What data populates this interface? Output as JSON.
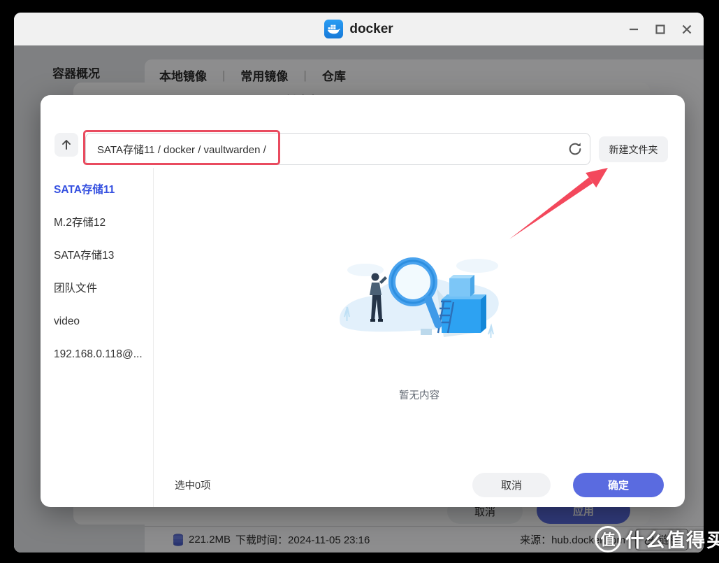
{
  "window": {
    "title": "docker"
  },
  "background": {
    "nav_item": "容器概况",
    "tabs": [
      "本地镜像",
      "常用镜像",
      "仓库"
    ],
    "tab_separator": "|",
    "dialog_title": "创建容器 vaultwarden/server",
    "cancel_label": "取消",
    "apply_label": "应用",
    "image_size": "221.2MB",
    "download_time": "下载时间：2024-11-05 23:16",
    "source": "来源：hub.docker.com",
    "link_label": "链接"
  },
  "file_dialog": {
    "path_value": "SATA存储11 / docker / vaultwarden /",
    "new_folder_label": "新建文件夹",
    "volumes": [
      "SATA存储11",
      "M.2存储12",
      "SATA存储13",
      "团队文件",
      "video",
      "192.168.0.118@..."
    ],
    "empty_text": "暂无内容",
    "selection_status": "选中0项",
    "cancel_label": "取消",
    "confirm_label": "确定"
  },
  "watermark": {
    "badge": "值",
    "text": "什么值得买"
  },
  "colors": {
    "accent_button": "#5a6be0",
    "selected_volume": "#3550e0",
    "annotation_red": "#e94b5f",
    "docker_icon_blue": "#2496ed",
    "titlebar": "#f1f1f1"
  }
}
